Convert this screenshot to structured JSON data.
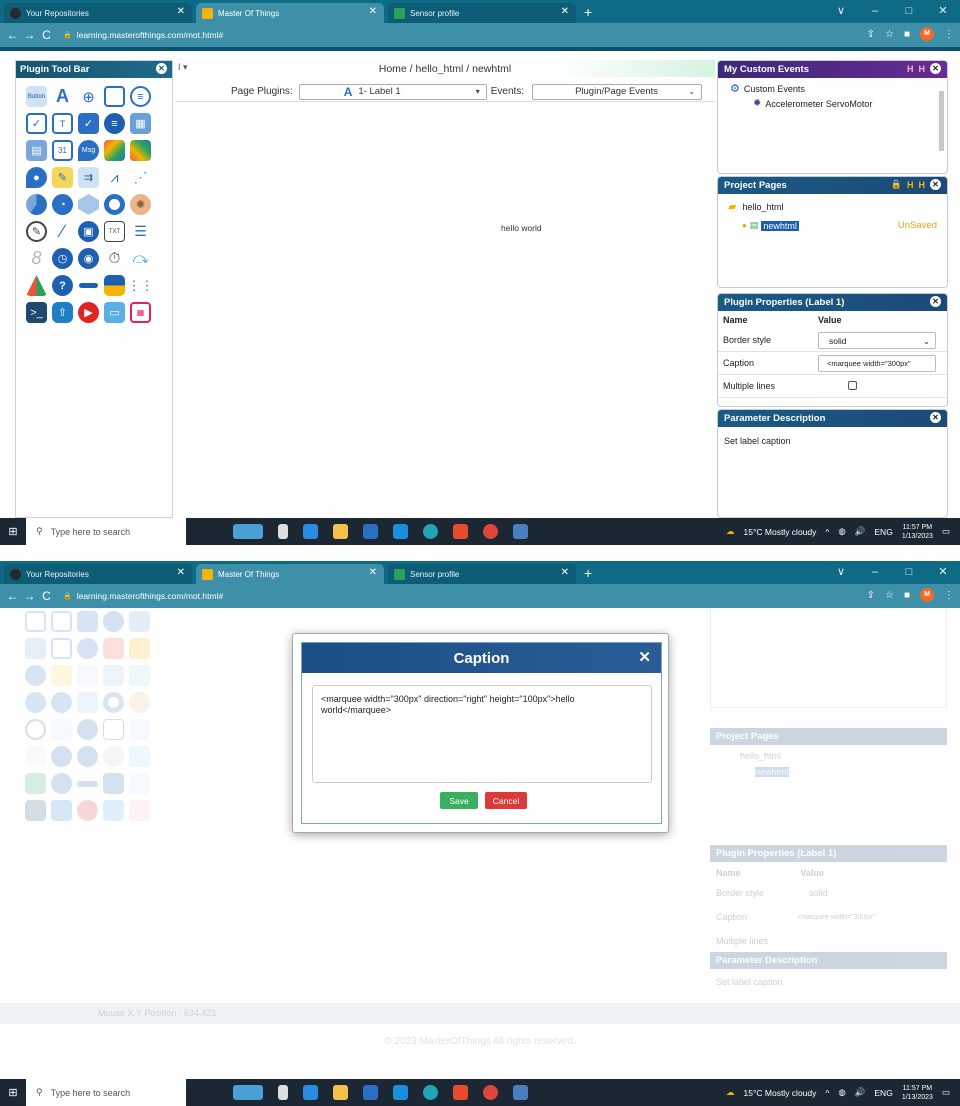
{
  "browser": {
    "tabs": [
      {
        "label": "Your Repositories",
        "icon": "github-icon",
        "color": "#24292e"
      },
      {
        "label": "Master Of Things",
        "icon": "mot-icon",
        "color": "#f5b400"
      },
      {
        "label": "Sensor profile",
        "icon": "sensor-icon",
        "color": "#2aa35a"
      }
    ],
    "new_tab": "+",
    "url": "learning.masterofthings.com/mot.html#",
    "profile": "M",
    "window_controls": [
      "∨",
      "–",
      "□",
      "✕"
    ]
  },
  "screen1": {
    "toolbar_title": "Plugin Tool Bar",
    "breadcrumb": "Home  /  hello_html  /  newhtml",
    "breadcrumb_dropdown": "I ▾",
    "page_plugins_label": "Page Plugins:",
    "page_plugins_value": "1- Label 1",
    "events_label": "Events:",
    "events_value": "Plugin/Page Events",
    "canvas_text": "hello world",
    "custom_events": {
      "title": "My Custom Events",
      "root": "Custom Events",
      "child": "Accelerometer ServoMotor"
    },
    "project_pages": {
      "title": "Project Pages",
      "folder": "hello_html",
      "page": "newhtml",
      "status": "UnSaved"
    },
    "plugin_properties": {
      "title": "Plugin Properties (Label 1)",
      "col_name": "Name",
      "col_value": "Value",
      "rows": [
        {
          "name": "Border style",
          "value": "solid"
        },
        {
          "name": "Caption",
          "value": "<marquee width=\"300px\""
        },
        {
          "name": "Multiple lines",
          "value": ""
        }
      ]
    },
    "parameter_description": {
      "title": "Parameter Description",
      "text": "Set label caption"
    }
  },
  "screen2": {
    "dialog_title": "Caption",
    "dialog_close": "✕",
    "caption_text": "<marquee width=\"300px\" direction=\"right\" height=\"100px\">hello world</marquee>",
    "save": "Save",
    "cancel": "Cancel",
    "mouse_position": "Mouse X,Y Position : 634,421",
    "footer": "© 2023 MasterOfThings All rights reserved.",
    "bg_panels": {
      "project_pages": "Project Pages",
      "folder": "hello_html",
      "page": "newhtml",
      "plugin_properties": "Plugin Properties (Label 1)",
      "name": "Name",
      "value": "Value",
      "border": "Border style",
      "solid": "solid",
      "caption": "Caption",
      "caption_value": "<marquee width=\"300px\"",
      "multiple": "Multiple lines",
      "param": "Parameter Description",
      "param_text": "Set label caption"
    }
  },
  "taskbar": {
    "search_placeholder": "Type here to search",
    "weather": "15°C  Mostly cloudy",
    "language": "ENG",
    "time": "11:57 PM",
    "date": "1/13/2023"
  },
  "colors": {
    "chrome": "#0f6a86",
    "header_blue": "#17546f",
    "custom_events_purple": "#5a2d8c",
    "save_green": "#39b060",
    "cancel_red": "#dc3a3a",
    "unsaved_orange": "#f39c12"
  }
}
